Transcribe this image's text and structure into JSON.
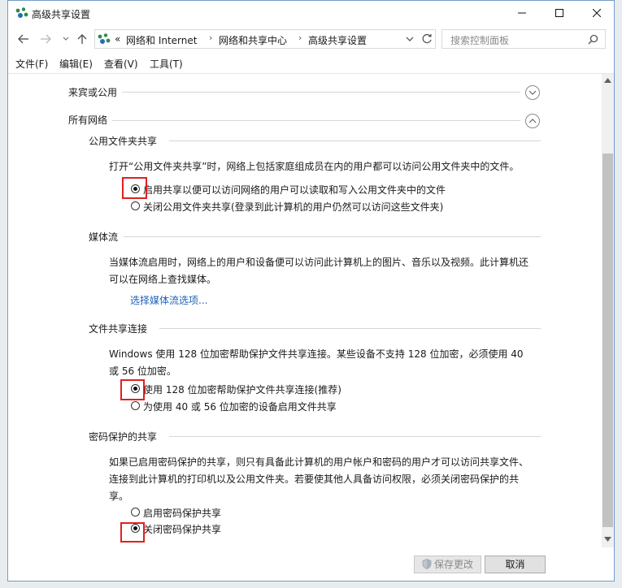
{
  "window": {
    "title": "高级共享设置"
  },
  "address": {
    "overflow": "«",
    "crumbs": [
      "网络和 Internet",
      "网络和共享中心",
      "高级共享设置"
    ]
  },
  "search": {
    "placeholder": "搜索控制面板"
  },
  "menu": [
    "文件(F)",
    "编辑(E)",
    "查看(V)",
    "工具(T)"
  ],
  "sections": {
    "guest": {
      "title": "来宾或公用"
    },
    "all": {
      "title": "所有网络"
    },
    "public_folder": {
      "title": "公用文件夹共享",
      "desc": "打开“公用文件夹共享”时，网络上包括家庭组成员在内的用户都可以访问公用文件夹中的文件。",
      "opt_on": "启用共享以便可以访问网络的用户可以读取和写入公用文件夹中的文件",
      "opt_off": "关闭公用文件夹共享(登录到此计算机的用户仍然可以访问这些文件夹)"
    },
    "media": {
      "title": "媒体流",
      "desc": "当媒体流启用时，网络上的用户和设备便可以访问此计算机上的图片、音乐以及视频。此计算机还可以在网络上查找媒体。",
      "link": "选择媒体流选项..."
    },
    "file_conn": {
      "title": "文件共享连接",
      "desc": "Windows 使用 128 位加密帮助保护文件共享连接。某些设备不支持 128 位加密，必须使用 40 或 56 位加密。",
      "opt_128": "使用 128 位加密帮助保护文件共享连接(推荐)",
      "opt_40": "为使用 40 或 56 位加密的设备启用文件共享"
    },
    "password": {
      "title": "密码保护的共享",
      "desc": "如果已启用密码保护的共享，则只有具备此计算机的用户帐户和密码的用户才可以访问共享文件、连接到此计算机的打印机以及公用文件夹。若要使其他人具备访问权限，必须关闭密码保护的共享。",
      "opt_on": "启用密码保护共享",
      "opt_off": "关闭密码保护共享"
    }
  },
  "buttons": {
    "save": "保存更改",
    "cancel": "取消"
  },
  "colors": {
    "accent_link": "#1c62b9",
    "highlight_box": "#e02020"
  }
}
